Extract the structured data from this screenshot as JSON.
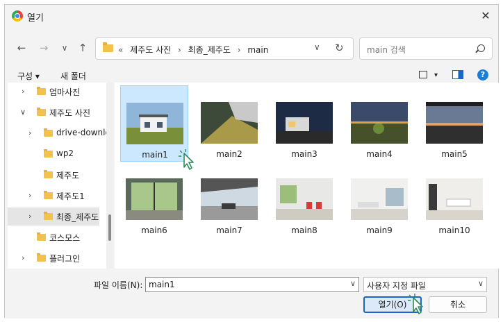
{
  "window": {
    "title": "열기",
    "close": "✕"
  },
  "nav": {
    "back": "←",
    "forward": "→",
    "recent": "∨",
    "up": "↑",
    "breadcrumb": [
      "«",
      "제주도 사진",
      "›",
      "최종_제주도",
      "›",
      "main"
    ],
    "dropdown": "∨",
    "refresh": "↻",
    "search_placeholder": "main 검색"
  },
  "commandbar": {
    "organize": "구성 ▾",
    "new_folder": "새 폴더",
    "view_dropdown": "▾",
    "help": "?"
  },
  "tree": [
    {
      "label": "엄마사진",
      "chevron": "›"
    },
    {
      "label": "제주도 사진",
      "chevron": "∨"
    },
    {
      "label": "drive-downlo",
      "chevron": "›"
    },
    {
      "label": "wp2",
      "chevron": ""
    },
    {
      "label": "제주도",
      "chevron": ""
    },
    {
      "label": "제주도1",
      "chevron": "›"
    },
    {
      "label": "최종_제주도",
      "chevron": "›",
      "selected": true
    },
    {
      "label": "코스모스",
      "chevron": ""
    },
    {
      "label": "플러그인",
      "chevron": "›"
    }
  ],
  "files": [
    {
      "name": "main1",
      "selected": true
    },
    {
      "name": "main2"
    },
    {
      "name": "main3"
    },
    {
      "name": "main4"
    },
    {
      "name": "main5"
    },
    {
      "name": "main6"
    },
    {
      "name": "main7"
    },
    {
      "name": "main8"
    },
    {
      "name": "main9"
    },
    {
      "name": "main10"
    }
  ],
  "footer": {
    "filename_label": "파일 이름(N):",
    "filename_value": "main1",
    "filetype_value": "사용자 지정 파일",
    "chevron": "∨",
    "open_button": "열기(O)",
    "cancel_button": "취소"
  },
  "colors": {
    "accent": "#1a66c4",
    "selection": "#cce8ff",
    "cursor": "#3cb371"
  }
}
